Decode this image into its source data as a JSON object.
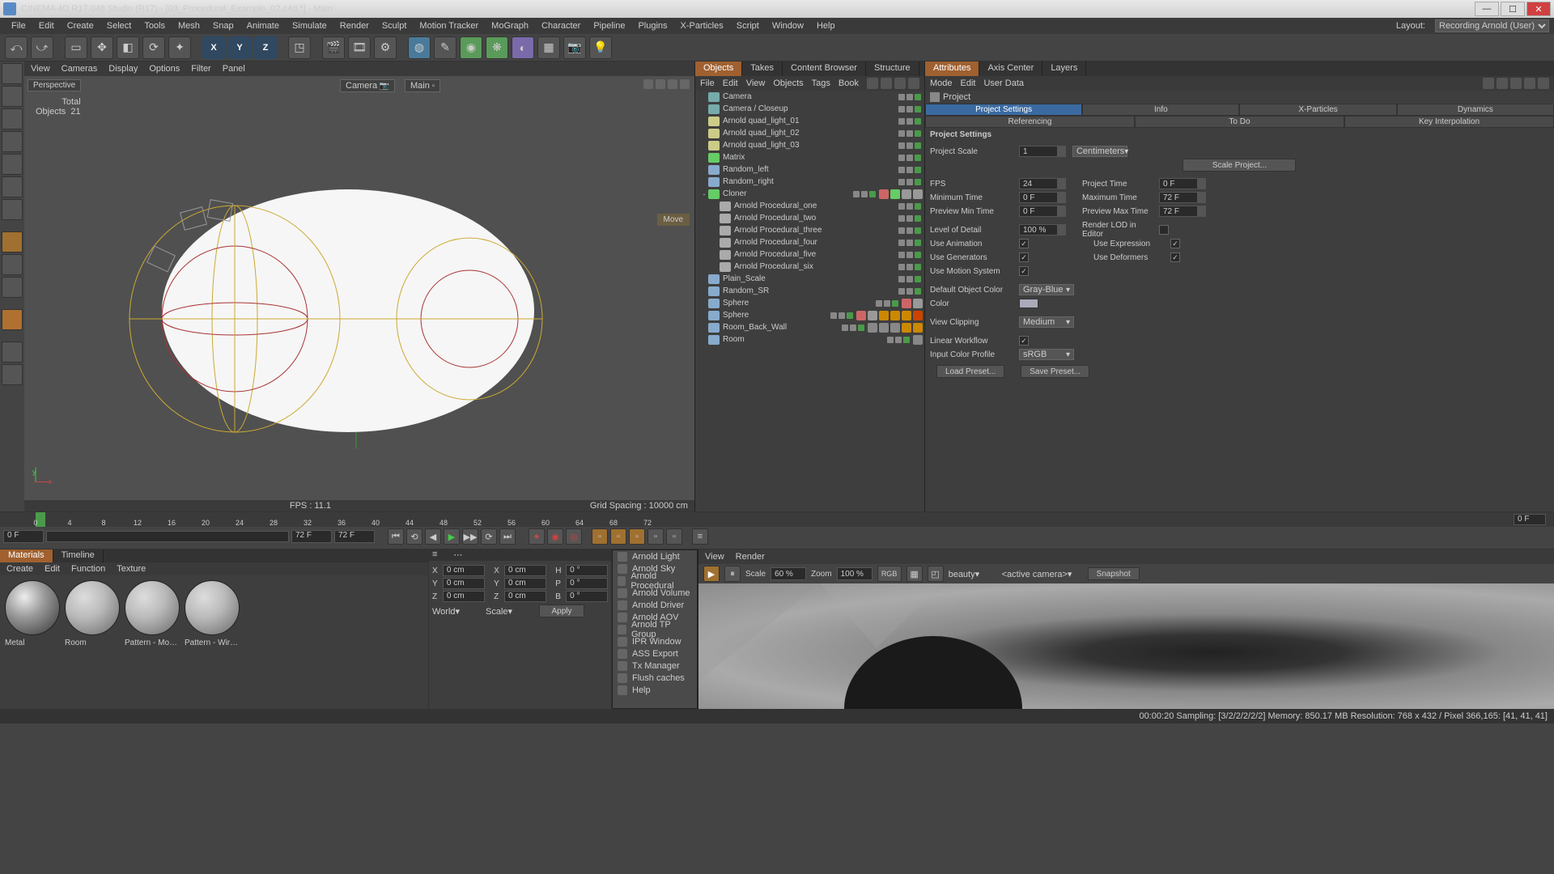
{
  "title": "CINEMA 4D R17.048 Studio (R17) - [03_Procedural_Example_02.c4d *] - Main",
  "menus": [
    "File",
    "Edit",
    "Create",
    "Select",
    "Tools",
    "Mesh",
    "Snap",
    "Animate",
    "Simulate",
    "Render",
    "Sculpt",
    "Motion Tracker",
    "MoGraph",
    "Character",
    "Pipeline",
    "Plugins",
    "X-Particles",
    "Script",
    "Window",
    "Help"
  ],
  "layout_label": "Layout:",
  "layout_value": "Recording Arnold (User)",
  "axis_buttons": [
    "X",
    "Y",
    "Z"
  ],
  "vp_menu": [
    "View",
    "Cameras",
    "Display",
    "Options",
    "Filter",
    "Panel"
  ],
  "vp_tag_persp": "Perspective",
  "vp_tag_cam": "Camera",
  "vp_tag_main": "Main",
  "vp_stats": {
    "total_l": "Total",
    "total_v": "",
    "obj_l": "Objects",
    "obj_v": "21"
  },
  "vp_fps": "FPS : 11.1",
  "vp_grid": "Grid Spacing : 10000 cm",
  "vp_move": "Move",
  "obj_tabs": [
    "Objects",
    "Takes",
    "Content Browser",
    "Structure"
  ],
  "obj_menu": [
    "File",
    "Edit",
    "View",
    "Objects",
    "Tags",
    "Book"
  ],
  "objects": [
    {
      "i": 0,
      "n": "Camera",
      "c": "#7aa"
    },
    {
      "i": 0,
      "n": "Camera / Closeup",
      "c": "#7aa"
    },
    {
      "i": 0,
      "n": "Arnold quad_light_01",
      "c": "#cc8"
    },
    {
      "i": 0,
      "n": "Arnold quad_light_02",
      "c": "#cc8"
    },
    {
      "i": 0,
      "n": "Arnold quad_light_03",
      "c": "#cc8"
    },
    {
      "i": 0,
      "n": "Matrix",
      "c": "#6c6"
    },
    {
      "i": 0,
      "n": "Random_left",
      "c": "#8ac"
    },
    {
      "i": 0,
      "n": "Random_right",
      "c": "#8ac"
    },
    {
      "i": 0,
      "n": "Cloner",
      "c": "#6c6",
      "exp": "-",
      "tags": [
        "#c66",
        "#6c6",
        "#999",
        "#999"
      ]
    },
    {
      "i": 1,
      "n": "Arnold Procedural_one",
      "c": "#aaa"
    },
    {
      "i": 1,
      "n": "Arnold Procedural_two",
      "c": "#aaa"
    },
    {
      "i": 1,
      "n": "Arnold Procedural_three",
      "c": "#aaa"
    },
    {
      "i": 1,
      "n": "Arnold Procedural_four",
      "c": "#aaa"
    },
    {
      "i": 1,
      "n": "Arnold Procedural_five",
      "c": "#aaa"
    },
    {
      "i": 1,
      "n": "Arnold Procedural_six",
      "c": "#aaa"
    },
    {
      "i": 0,
      "n": "Plain_Scale",
      "c": "#8ac"
    },
    {
      "i": 0,
      "n": "Random_SR",
      "c": "#8ac"
    },
    {
      "i": 0,
      "n": "Sphere",
      "c": "#8ac",
      "tags": [
        "#c66",
        "#999"
      ]
    },
    {
      "i": 0,
      "n": "Sphere",
      "c": "#8ac",
      "tags": [
        "#c66",
        "#999",
        "#c80",
        "#c80",
        "#c80",
        "#c40"
      ]
    },
    {
      "i": 0,
      "n": "Room_Back_Wall",
      "c": "#8ac",
      "tags": [
        "#888",
        "#888",
        "#888",
        "#c80",
        "#c80"
      ]
    },
    {
      "i": 0,
      "n": "Room",
      "c": "#8ac",
      "tags": [
        "#888"
      ]
    }
  ],
  "attr_tabs": [
    "Attributes",
    "Axis Center",
    "Layers"
  ],
  "attr_menu": [
    "Mode",
    "Edit",
    "User Data"
  ],
  "attr_title": "Project",
  "attr_subtabs1": [
    "Project Settings",
    "Info",
    "X-Particles",
    "Dynamics"
  ],
  "attr_subtabs2": [
    "Referencing",
    "To Do",
    "Key Interpolation"
  ],
  "attr_section": "Project Settings",
  "attrs": {
    "scale_l": "Project Scale",
    "scale_v": "1",
    "scale_u": "Centimeters",
    "scale_btn": "Scale Project...",
    "fps_l": "FPS",
    "fps_v": "24",
    "ptime_l": "Project Time",
    "ptime_v": "0 F",
    "min_l": "Minimum Time",
    "min_v": "0 F",
    "max_l": "Maximum Time",
    "max_v": "72 F",
    "pmin_l": "Preview Min Time",
    "pmin_v": "0 F",
    "pmax_l": "Preview Max Time",
    "pmax_v": "72 F",
    "lod_l": "Level of Detail",
    "lod_v": "100 %",
    "rlod_l": "Render LOD in Editor",
    "anim_l": "Use Animation",
    "expr_l": "Use Expression",
    "gen_l": "Use Generators",
    "def_l": "Use Deformers",
    "mot_l": "Use Motion System",
    "defc_l": "Default Object Color",
    "defc_v": "Gray-Blue",
    "col_l": "Color",
    "clip_l": "View Clipping",
    "clip_v": "Medium",
    "lwf_l": "Linear Workflow",
    "icp_l": "Input Color Profile",
    "icp_v": "sRGB",
    "load": "Load Preset...",
    "save": "Save Preset..."
  },
  "tl_ticks": [
    "0",
    "4",
    "8",
    "12",
    "16",
    "20",
    "24",
    "28",
    "32",
    "36",
    "40",
    "44",
    "48",
    "52",
    "56",
    "60",
    "64",
    "68",
    "72"
  ],
  "tl_cur": "0 F",
  "tl_f1": "0 F",
  "tl_f2": "72 F",
  "tl_f3": "72 F",
  "mat_tabs": [
    "Materials",
    "Timeline"
  ],
  "mat_menu": [
    "Create",
    "Edit",
    "Function",
    "Texture"
  ],
  "materials": [
    "Metal",
    "Room",
    "Pattern - Monod",
    "Pattern - Wirefra"
  ],
  "coord": {
    "x_l": "X",
    "x_v": "0 cm",
    "sx_l": "X",
    "sx_v": "0 cm",
    "h_l": "H",
    "h_v": "0 °",
    "y_l": "Y",
    "y_v": "0 cm",
    "sy_l": "Y",
    "sy_v": "0 cm",
    "p_l": "P",
    "p_v": "0 °",
    "z_l": "Z",
    "z_v": "0 cm",
    "sz_l": "Z",
    "sz_v": "0 cm",
    "b_l": "B",
    "b_v": "0 °",
    "world": "World",
    "scale": "Scale",
    "apply": "Apply"
  },
  "ctx": [
    "Arnold Light",
    "Arnold Sky",
    "Arnold Procedural",
    "Arnold Volume",
    "Arnold Driver",
    "Arnold AOV",
    "Arnold TP Group",
    "IPR Window",
    "ASS Export",
    "Tx Manager",
    "Flush caches",
    "Help"
  ],
  "ipr_menu": [
    "View",
    "Render"
  ],
  "ipr": {
    "scale_l": "Scale",
    "scale_v": "60 %",
    "zoom_l": "Zoom",
    "zoom_v": "100 %",
    "rgb": "RGB",
    "beauty": "beauty",
    "cam": "<active camera>",
    "snap": "Snapshot"
  },
  "status": "00:00:20   Sampling: [3/2/2/2/2/2]   Memory: 850.17 MB   Resolution: 768 x 432 / Pixel 366,165: [41, 41, 41]"
}
